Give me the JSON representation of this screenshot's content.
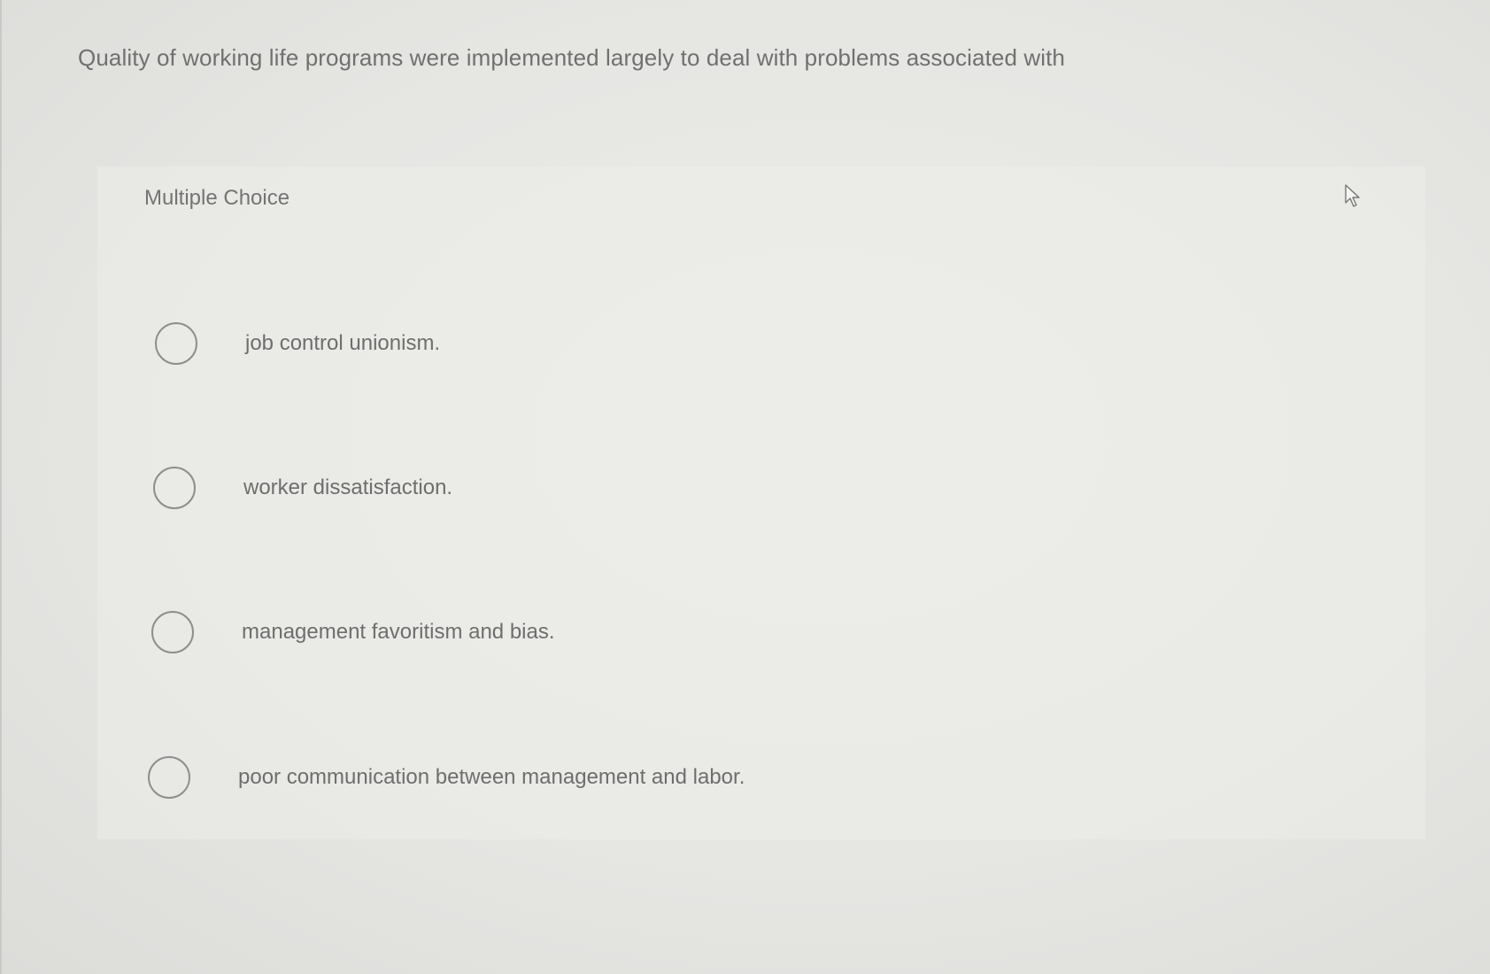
{
  "question": {
    "text": "Quality of working life programs were implemented largely to deal with problems associated with"
  },
  "answer_section": {
    "type_label": "Multiple Choice",
    "options": [
      {
        "label": "job control unionism."
      },
      {
        "label": "worker dissatisfaction."
      },
      {
        "label": "management favoritism and bias."
      },
      {
        "label": "poor communication between management and labor."
      }
    ]
  },
  "icons": {
    "pointer": "mouse-pointer-icon",
    "radio": "radio-circle-icon"
  },
  "colors": {
    "background": "#e6e6e3",
    "text": "#6e6e6e",
    "radio_border": "#8e8e8e"
  }
}
